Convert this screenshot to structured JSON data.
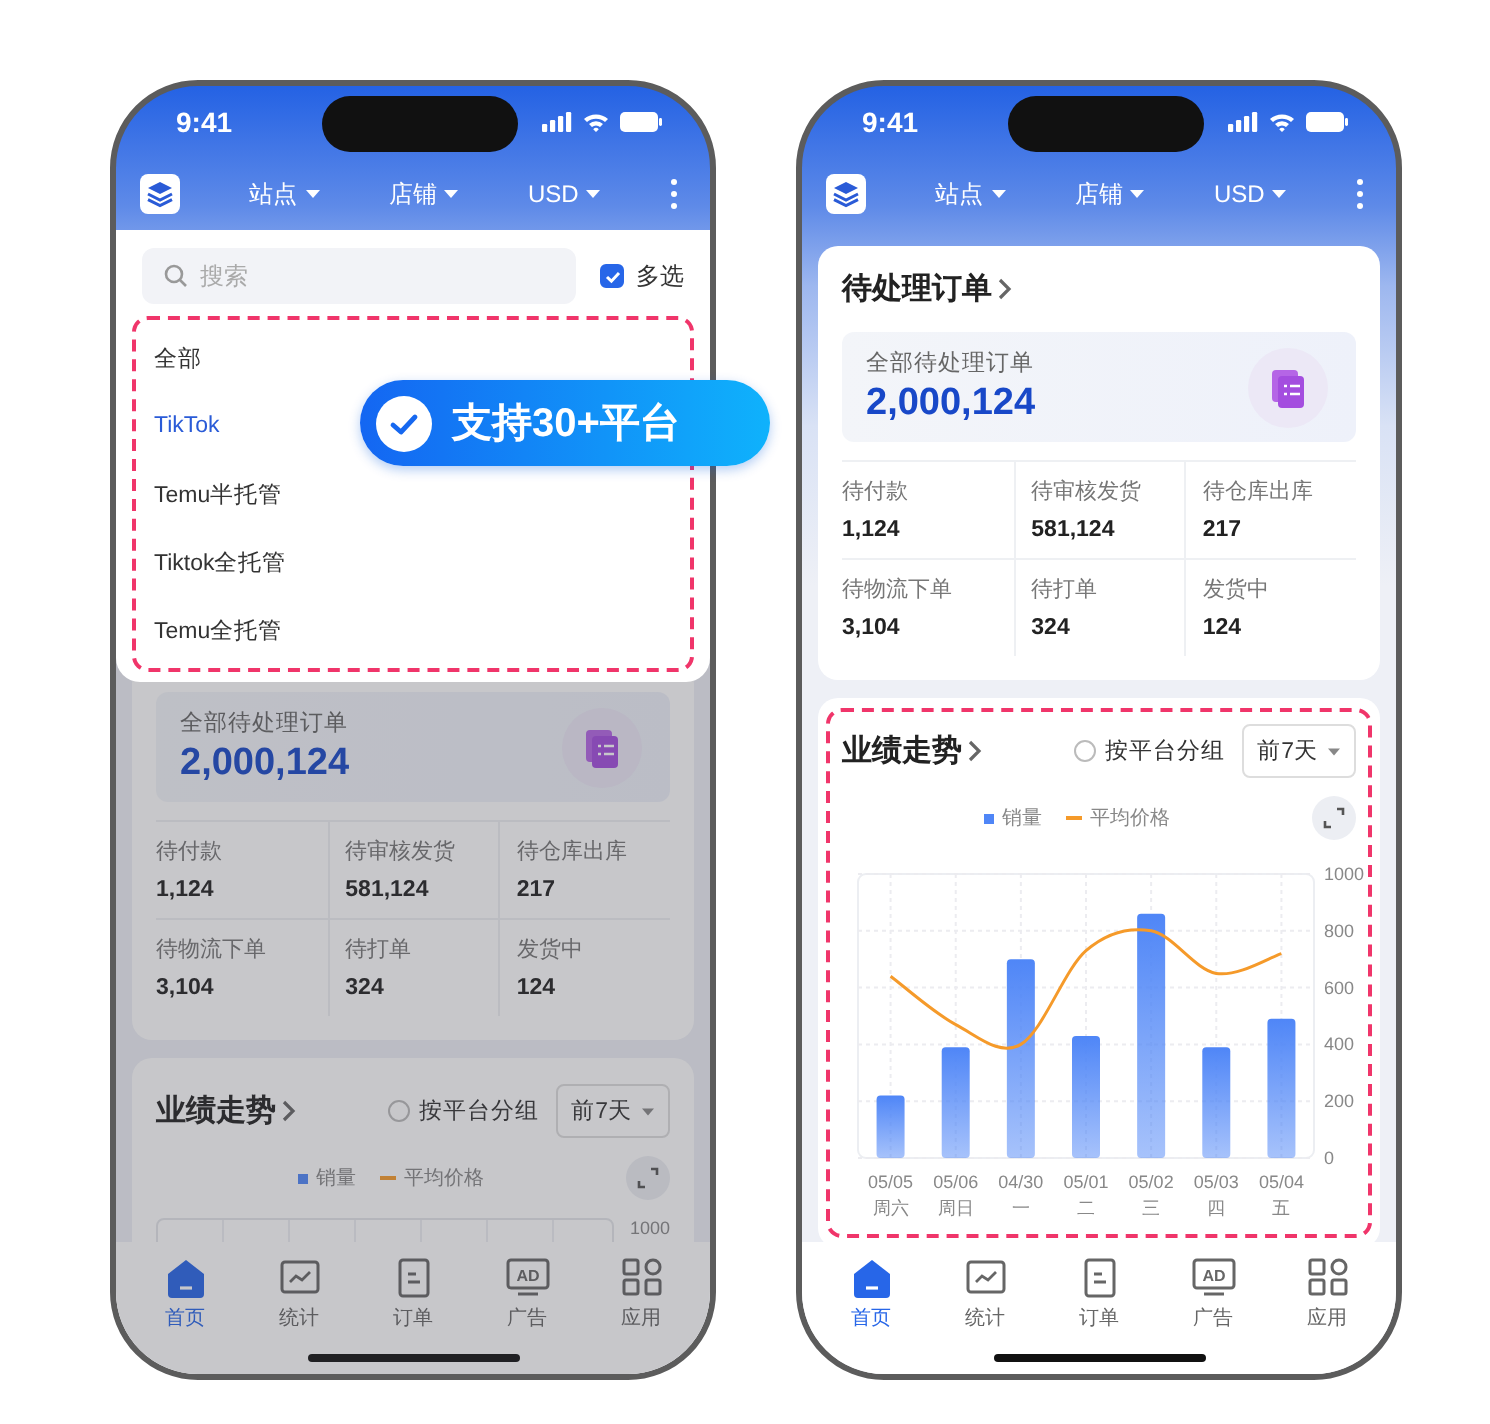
{
  "phones": [
    {
      "status_bar": {
        "time": "9:41"
      },
      "app_bar": {
        "filters": [
          {
            "label": "站点"
          },
          {
            "label": "店铺"
          },
          {
            "label": "USD"
          }
        ]
      },
      "dropdown": {
        "search": {
          "placeholder": "搜索"
        },
        "multi_select": {
          "label": "多选",
          "checked": true
        },
        "options": [
          {
            "label": "全部",
            "selected": false
          },
          {
            "label": "TikTok",
            "selected": true
          },
          {
            "label": "Temu半托管",
            "selected": false
          },
          {
            "label": "Tiktok全托管",
            "selected": false
          },
          {
            "label": "Temu全托管",
            "selected": false
          }
        ]
      },
      "callout": "支持30+平台",
      "pending_orders": {
        "summary_label": "全部待处理订单",
        "summary_value": "2,000,124",
        "stats": [
          {
            "label": "待付款",
            "value": "1,124"
          },
          {
            "label": "待审核发货",
            "value": "581,124"
          },
          {
            "label": "待仓库出库",
            "value": "217"
          },
          {
            "label": "待物流下单",
            "value": "3,104"
          },
          {
            "label": "待打单",
            "value": "324"
          },
          {
            "label": "发货中",
            "value": "124"
          }
        ]
      },
      "trend": {
        "title": "业绩走势",
        "group_toggle": {
          "label": "按平台分组",
          "checked": false
        },
        "range": "前7天",
        "legend": [
          {
            "label": "销量",
            "kind": "bar",
            "color": "#4c73c5"
          },
          {
            "label": "平均价格",
            "kind": "line",
            "color": "#c18135"
          }
        ],
        "axis_top_label": "1000"
      },
      "tab_bar": [
        {
          "label": "首页",
          "kind": "home",
          "selected": true
        },
        {
          "label": "统计",
          "kind": "stats",
          "selected": false
        },
        {
          "label": "订单",
          "kind": "orders",
          "selected": false
        },
        {
          "label": "广告",
          "kind": "ad",
          "icon_text": "AD",
          "selected": false
        },
        {
          "label": "应用",
          "kind": "apps",
          "selected": false
        }
      ]
    },
    {
      "status_bar": {
        "time": "9:41"
      },
      "app_bar": {
        "filters": [
          {
            "label": "站点"
          },
          {
            "label": "店铺"
          },
          {
            "label": "USD"
          }
        ]
      },
      "pending_orders": {
        "title": "待处理订单",
        "summary_label": "全部待处理订单",
        "summary_value": "2,000,124",
        "stats": [
          {
            "label": "待付款",
            "value": "1,124"
          },
          {
            "label": "待审核发货",
            "value": "581,124"
          },
          {
            "label": "待仓库出库",
            "value": "217"
          },
          {
            "label": "待物流下单",
            "value": "3,104"
          },
          {
            "label": "待打单",
            "value": "324"
          },
          {
            "label": "发货中",
            "value": "124"
          }
        ]
      },
      "trend": {
        "title": "业绩走势",
        "group_toggle": {
          "label": "按平台分组",
          "checked": false
        },
        "range": "前7天",
        "chart_data": {
          "type": "bar",
          "categories": [
            "05/05",
            "05/06",
            "04/30",
            "05/01",
            "05/02",
            "05/03",
            "05/04"
          ],
          "series": [
            {
              "name": "销量",
              "type": "bar",
              "color": "#4f86f7",
              "values": [
                220,
                390,
                700,
                430,
                860,
                390,
                490
              ]
            },
            {
              "name": "平均价格",
              "type": "line",
              "color": "#f59a2a",
              "values": [
                640,
                470,
                400,
                730,
                800,
                650,
                720
              ]
            }
          ],
          "ylim": [
            0,
            1000
          ],
          "yticks": [
            0,
            200,
            400,
            600,
            800,
            1000
          ],
          "grid": true
        },
        "weekdays": [
          "周六",
          "周日",
          "一",
          "二",
          "三",
          "四",
          "五"
        ]
      },
      "tab_bar": [
        {
          "label": "首页",
          "kind": "home",
          "selected": true
        },
        {
          "label": "统计",
          "kind": "stats",
          "selected": false
        },
        {
          "label": "订单",
          "kind": "orders",
          "selected": false
        },
        {
          "label": "广告",
          "kind": "ad",
          "icon_text": "AD",
          "selected": false
        },
        {
          "label": "应用",
          "kind": "apps",
          "selected": false
        }
      ]
    }
  ]
}
